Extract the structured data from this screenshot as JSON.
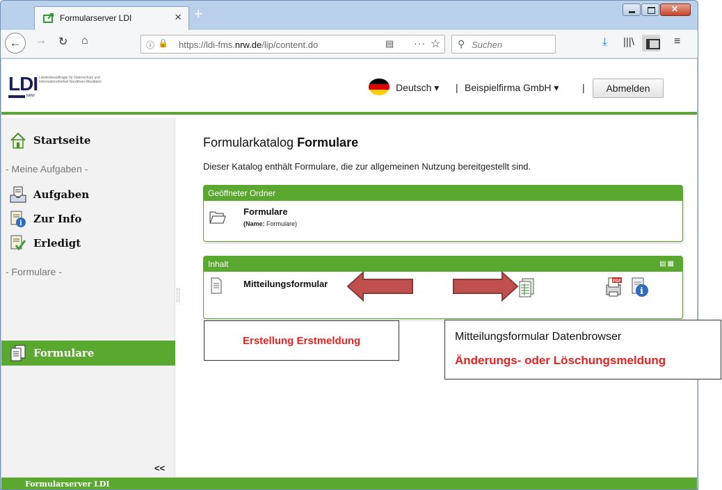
{
  "browser": {
    "tab_title": "Formularserver LDI",
    "tab_close": "×",
    "new_tab": "+",
    "url_prefix": "https://ldi-fms.",
    "url_domain": "nrw.de",
    "url_path": "/lip/content.do",
    "url_more": "···",
    "search_placeholder": "Suchen"
  },
  "header": {
    "logo_mark": "LDI",
    "logo_sub": "NRW",
    "logo_text": "Landesbeauftragte für Datenschutz und Informationsfreiheit Nordrhein-Westfalen",
    "language": "Deutsch ▾",
    "separator": "|",
    "company": "Beispielfirma GmbH ▾",
    "logout_label": "Abmelden"
  },
  "sidebar": {
    "home": "Startseite",
    "section_tasks": "- Meine Aufgaben -",
    "tasks": "Aufgaben",
    "info": "Zur Info",
    "done": "Erledigt",
    "section_forms": "- Formulare -",
    "forms": "Formulare",
    "collapse": "<<"
  },
  "main": {
    "title_prefix": "Formularkatalog ",
    "title_bold": "Formulare",
    "description": "Dieser Katalog enthält Formulare, die zur allgemeinen Nutzung bereitgestellt sind.",
    "folder_panel_title": "Geöffneter Ordner",
    "folder_name": "Formulare",
    "folder_sub_label": "(Name:",
    "folder_sub_value": " Formulare)",
    "content_panel_title": "Inhalt",
    "form_name": "Mitteilungsformular"
  },
  "annotations": {
    "left_callout": "Erstellung Erstmeldung",
    "right_callout_line1": "Mitteilungsformular Datenbrowser",
    "right_callout_line2": "Änderungs- oder Löschungsmeldung"
  },
  "footer": {
    "text": "Formularserver LDI"
  },
  "icons": {
    "tab_favicon": "form-favicon-icon",
    "home": "house-icon",
    "tasks": "inbox-icon",
    "info": "info-document-icon",
    "done": "checked-document-icon",
    "forms": "documents-icon",
    "folder": "open-folder-icon",
    "form": "document-icon",
    "databrowser": "table-icon",
    "pdf": "pdf-icon",
    "form_info": "info-icon"
  },
  "colors": {
    "accent_green": "#5aa82f",
    "annotation_red": "#e8231f",
    "arrow_fill": "#c0504d"
  }
}
